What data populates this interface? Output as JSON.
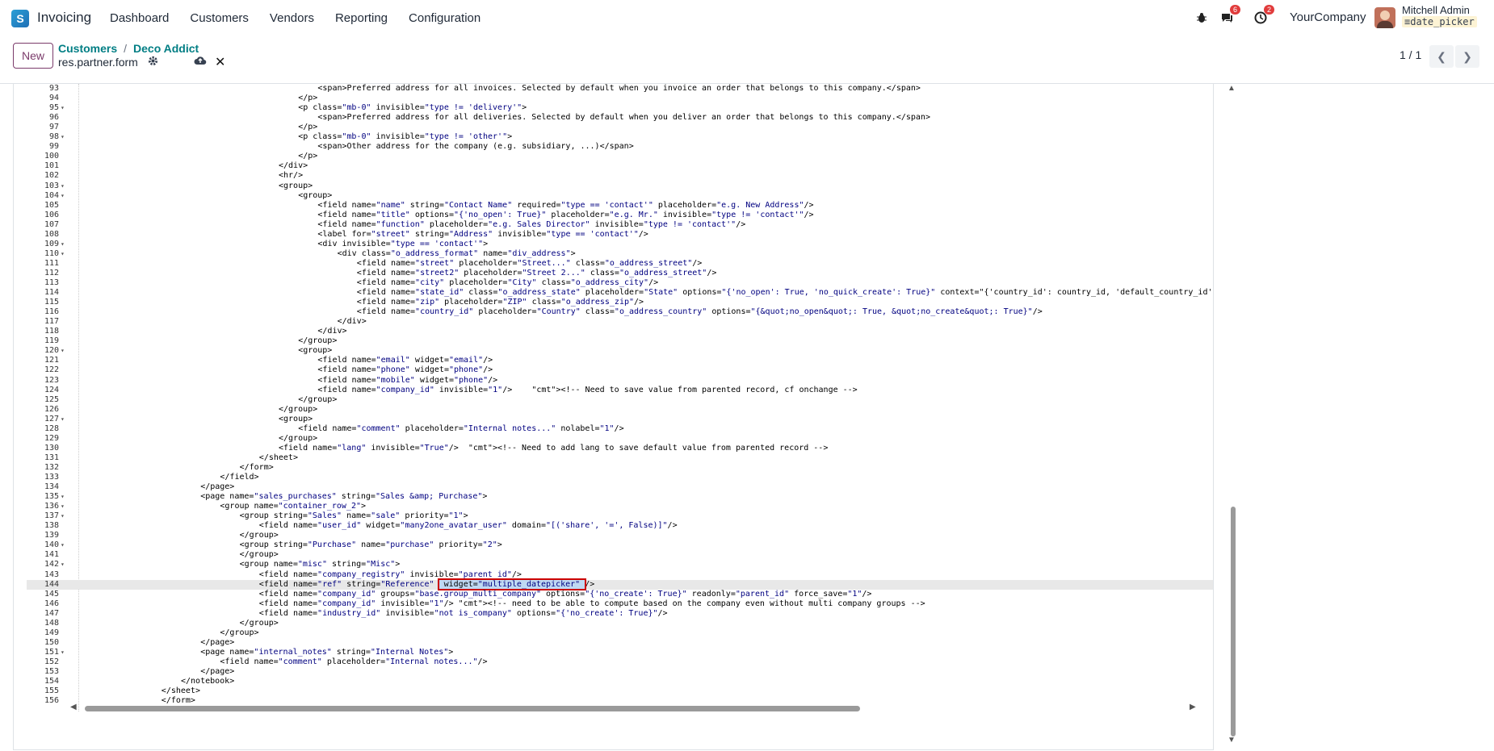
{
  "navbar": {
    "logo_letter": "S",
    "app_name": "Invoicing",
    "menu": [
      "Dashboard",
      "Customers",
      "Vendors",
      "Reporting",
      "Configuration"
    ],
    "messages_count": "6",
    "activities_count": "2",
    "company": "YourCompany",
    "user_name": "Mitchell Admin",
    "db_name": "date_picker"
  },
  "control": {
    "new_label": "New",
    "breadcrumb_parent": "Customers",
    "breadcrumb_separator": "/",
    "breadcrumb_current": "Deco Addict",
    "record_name": "res.partner.form",
    "pager": "1 / 1"
  },
  "code_lines": [
    {
      "n": "93",
      "f": "",
      "i": 12,
      "t": "<span>Preferred address for all invoices. Selected by default when you invoice an order that belongs to this company.</span>"
    },
    {
      "n": "94",
      "f": "",
      "i": 11,
      "t": "</p>"
    },
    {
      "n": "95",
      "f": "▾",
      "i": 11,
      "t": "<p class=\"mb-0\" invisible=\"type != 'delivery'\">"
    },
    {
      "n": "96",
      "f": "",
      "i": 12,
      "t": "<span>Preferred address for all deliveries. Selected by default when you deliver an order that belongs to this company.</span>"
    },
    {
      "n": "97",
      "f": "",
      "i": 11,
      "t": "</p>"
    },
    {
      "n": "98",
      "f": "▾",
      "i": 11,
      "t": "<p class=\"mb-0\" invisible=\"type != 'other'\">"
    },
    {
      "n": "99",
      "f": "",
      "i": 12,
      "t": "<span>Other address for the company (e.g. subsidiary, ...)</span>"
    },
    {
      "n": "100",
      "f": "",
      "i": 11,
      "t": "</p>"
    },
    {
      "n": "101",
      "f": "",
      "i": 10,
      "t": "</div>"
    },
    {
      "n": "102",
      "f": "",
      "i": 10,
      "t": "<hr/>"
    },
    {
      "n": "103",
      "f": "▾",
      "i": 10,
      "t": "<group>"
    },
    {
      "n": "104",
      "f": "▾",
      "i": 11,
      "t": "<group>"
    },
    {
      "n": "105",
      "f": "",
      "i": 12,
      "t": "<field name=\"name\" string=\"Contact Name\" required=\"type == 'contact'\" placeholder=\"e.g. New Address\"/>"
    },
    {
      "n": "106",
      "f": "",
      "i": 12,
      "t": "<field name=\"title\" options=\"{'no_open': True}\" placeholder=\"e.g. Mr.\" invisible=\"type != 'contact'\"/>"
    },
    {
      "n": "107",
      "f": "",
      "i": 12,
      "t": "<field name=\"function\" placeholder=\"e.g. Sales Director\" invisible=\"type != 'contact'\"/>"
    },
    {
      "n": "108",
      "f": "",
      "i": 12,
      "t": "<label for=\"street\" string=\"Address\" invisible=\"type == 'contact'\"/>"
    },
    {
      "n": "109",
      "f": "▾",
      "i": 12,
      "t": "<div invisible=\"type == 'contact'\">"
    },
    {
      "n": "110",
      "f": "▾",
      "i": 13,
      "t": "<div class=\"o_address_format\" name=\"div_address\">"
    },
    {
      "n": "111",
      "f": "",
      "i": 14,
      "t": "<field name=\"street\" placeholder=\"Street...\" class=\"o_address_street\"/>"
    },
    {
      "n": "112",
      "f": "",
      "i": 14,
      "t": "<field name=\"street2\" placeholder=\"Street 2...\" class=\"o_address_street\"/>"
    },
    {
      "n": "113",
      "f": "",
      "i": 14,
      "t": "<field name=\"city\" placeholder=\"City\" class=\"o_address_city\"/>"
    },
    {
      "n": "114",
      "f": "",
      "i": 14,
      "t": "<field name=\"state_id\" class=\"o_address_state\" placeholder=\"State\" options=\"{'no_open': True, 'no_quick_create': True}\" context=\"{'country_id': country_id, 'default_country_id':"
    },
    {
      "n": "115",
      "f": "",
      "i": 14,
      "t": "<field name=\"zip\" placeholder=\"ZIP\" class=\"o_address_zip\"/>"
    },
    {
      "n": "116",
      "f": "",
      "i": 14,
      "t": "<field name=\"country_id\" placeholder=\"Country\" class=\"o_address_country\" options=\"{&quot;no_open&quot;: True, &quot;no_create&quot;: True}\"/>"
    },
    {
      "n": "117",
      "f": "",
      "i": 13,
      "t": "</div>"
    },
    {
      "n": "118",
      "f": "",
      "i": 12,
      "t": "</div>"
    },
    {
      "n": "119",
      "f": "",
      "i": 11,
      "t": "</group>"
    },
    {
      "n": "120",
      "f": "▾",
      "i": 11,
      "t": "<group>"
    },
    {
      "n": "121",
      "f": "",
      "i": 12,
      "t": "<field name=\"email\" widget=\"email\"/>"
    },
    {
      "n": "122",
      "f": "",
      "i": 12,
      "t": "<field name=\"phone\" widget=\"phone\"/>"
    },
    {
      "n": "123",
      "f": "",
      "i": 12,
      "t": "<field name=\"mobile\" widget=\"phone\"/>"
    },
    {
      "n": "124",
      "f": "",
      "i": 12,
      "t": "<field name=\"company_id\" invisible=\"1\"/>    <!-- Need to save value from parented record, cf onchange -->"
    },
    {
      "n": "125",
      "f": "",
      "i": 11,
      "t": "</group>"
    },
    {
      "n": "126",
      "f": "",
      "i": 10,
      "t": "</group>"
    },
    {
      "n": "127",
      "f": "▾",
      "i": 10,
      "t": "<group>"
    },
    {
      "n": "128",
      "f": "",
      "i": 11,
      "t": "<field name=\"comment\" placeholder=\"Internal notes...\" nolabel=\"1\"/>"
    },
    {
      "n": "129",
      "f": "",
      "i": 10,
      "t": "</group>"
    },
    {
      "n": "130",
      "f": "",
      "i": 10,
      "t": "<field name=\"lang\" invisible=\"True\"/>  <!-- Need to add lang to save default value from parented record -->"
    },
    {
      "n": "131",
      "f": "",
      "i": 9,
      "t": "</sheet>"
    },
    {
      "n": "132",
      "f": "",
      "i": 8,
      "t": "</form>"
    },
    {
      "n": "133",
      "f": "",
      "i": 7,
      "t": "</field>"
    },
    {
      "n": "134",
      "f": "",
      "i": 6,
      "t": "</page>"
    },
    {
      "n": "135",
      "f": "▾",
      "i": 6,
      "t": "<page name=\"sales_purchases\" string=\"Sales &amp; Purchase\">"
    },
    {
      "n": "136",
      "f": "▾",
      "i": 7,
      "t": "<group name=\"container_row_2\">"
    },
    {
      "n": "137",
      "f": "▾",
      "i": 8,
      "t": "<group string=\"Sales\" name=\"sale\" priority=\"1\">"
    },
    {
      "n": "138",
      "f": "",
      "i": 9,
      "t": "<field name=\"user_id\" widget=\"many2one_avatar_user\" domain=\"[('share', '=', False)]\"/>"
    },
    {
      "n": "139",
      "f": "",
      "i": 8,
      "t": "</group>"
    },
    {
      "n": "140",
      "f": "▾",
      "i": 8,
      "t": "<group string=\"Purchase\" name=\"purchase\" priority=\"2\">"
    },
    {
      "n": "141",
      "f": "",
      "i": 8,
      "t": "</group>"
    },
    {
      "n": "142",
      "f": "▾",
      "i": 8,
      "t": "<group name=\"misc\" string=\"Misc\">"
    },
    {
      "n": "143",
      "f": "",
      "i": 9,
      "t": "<field name=\"company_registry\" invisible=\"parent_id\"/>"
    },
    {
      "n": "144",
      "f": "",
      "i": 9,
      "t": "<field name=\"ref\" string=\"Reference\"  widget=\"multiple_datepicker\" />",
      "hl": true,
      "box": " widget=\"multiple_datepicker\" "
    },
    {
      "n": "145",
      "f": "",
      "i": 9,
      "t": "<field name=\"company_id\" groups=\"base.group_multi_company\" options=\"{'no_create': True}\" readonly=\"parent_id\" force_save=\"1\"/>"
    },
    {
      "n": "146",
      "f": "",
      "i": 9,
      "t": "<field name=\"company_id\" invisible=\"1\"/> <!-- need to be able to compute based on the company even without multi company groups -->"
    },
    {
      "n": "147",
      "f": "",
      "i": 9,
      "t": "<field name=\"industry_id\" invisible=\"not is_company\" options=\"{'no_create': True}\"/>"
    },
    {
      "n": "148",
      "f": "",
      "i": 8,
      "t": "</group>"
    },
    {
      "n": "149",
      "f": "",
      "i": 7,
      "t": "</group>"
    },
    {
      "n": "150",
      "f": "",
      "i": 6,
      "t": "</page>"
    },
    {
      "n": "151",
      "f": "▾",
      "i": 6,
      "t": "<page name=\"internal_notes\" string=\"Internal Notes\">"
    },
    {
      "n": "152",
      "f": "",
      "i": 7,
      "t": "<field name=\"comment\" placeholder=\"Internal notes...\"/>"
    },
    {
      "n": "153",
      "f": "",
      "i": 6,
      "t": "</page>"
    },
    {
      "n": "154",
      "f": "",
      "i": 5,
      "t": "</notebook>"
    },
    {
      "n": "155",
      "f": "",
      "i": 4,
      "t": "</sheet>"
    },
    {
      "n": "156",
      "f": "",
      "i": 4,
      "t": "</form>"
    }
  ]
}
